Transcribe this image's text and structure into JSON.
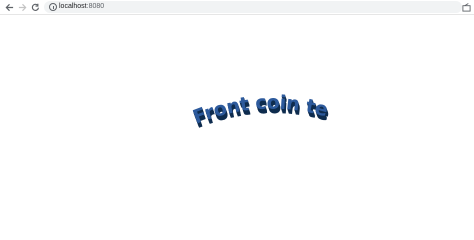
{
  "browser": {
    "url_host": "localhost",
    "url_port": ":8080"
  },
  "icons": {
    "back": "back-arrow-icon",
    "forward": "forward-arrow-icon",
    "reload": "reload-icon",
    "site_info": "info-icon",
    "share": "share-icon"
  },
  "canvas": {
    "text": "Front coin text",
    "front_color": "#2d5a9c",
    "edge_color": "#0f2c4e",
    "background": "#ffffff"
  }
}
